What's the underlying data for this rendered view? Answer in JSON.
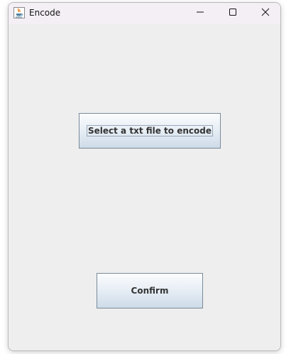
{
  "window": {
    "title": "Encode",
    "icon": "java-coffee-cup-icon",
    "controls": {
      "minimize_icon": "minimize-icon",
      "maximize_icon": "maximize-icon",
      "close_icon": "close-icon"
    }
  },
  "main": {
    "select_button_label": "Select a txt file to encode",
    "confirm_button_label": "Confirm"
  },
  "colors": {
    "window_background": "#eeeeee",
    "titlebar_background": "#f4eff5",
    "button_border": "#7a8a99",
    "button_text": "#333333"
  }
}
